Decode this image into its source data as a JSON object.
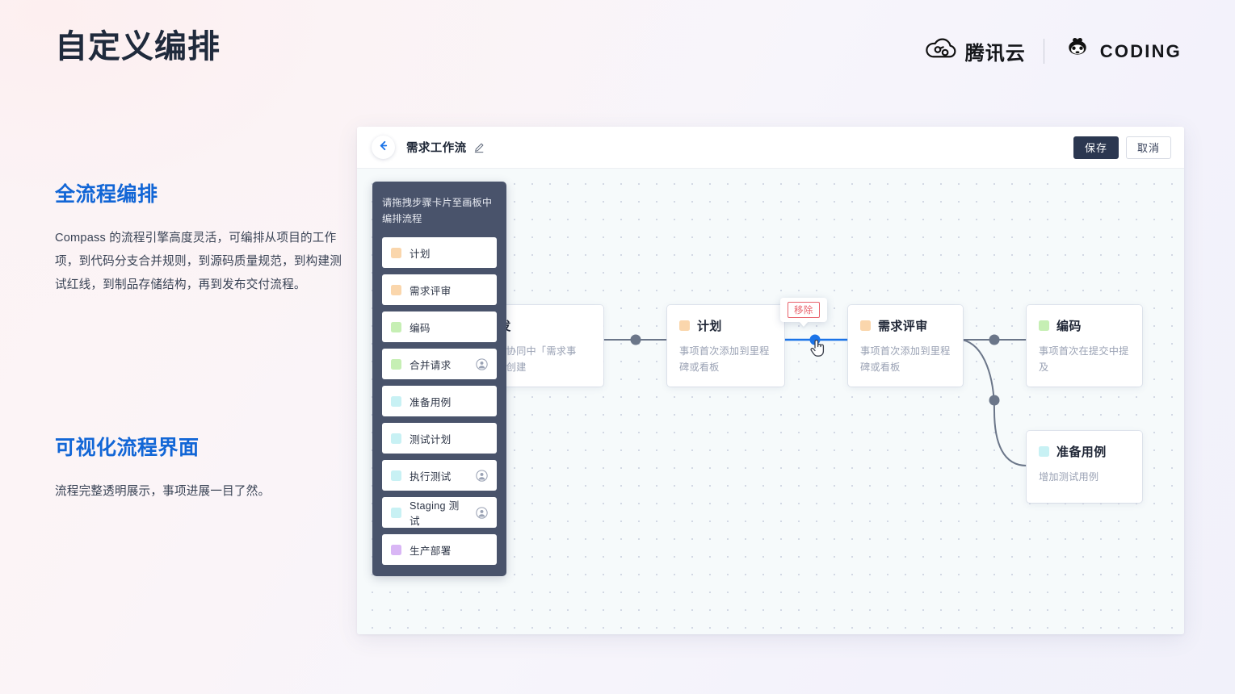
{
  "hero": {
    "title": "自定义编排"
  },
  "brand": {
    "tencent_cloud": "腾讯云",
    "coding": "CODING",
    "cloud_icon": "tencent-cloud-icon",
    "monkey_icon": "coding-monkey-icon"
  },
  "sections": [
    {
      "heading": "全流程编排",
      "body": "Compass 的流程引擎高度灵活，可编排从项目的工作项，到代码分支合并规则，到源码质量规范，到构建测试红线，到制品存储结构，再到发布交付流程。"
    },
    {
      "heading": "可视化流程界面",
      "body": "流程完整透明展示，事项进展一目了然。"
    }
  ],
  "app": {
    "toolbar": {
      "back_icon": "back-arrow-icon",
      "flow_name": "需求工作流",
      "edit_icon": "pencil-edit-icon",
      "save_label": "保存",
      "cancel_label": "取消"
    },
    "palette": {
      "hint": "请拖拽步骤卡片至画板中编排流程",
      "items": [
        {
          "label": "计划",
          "color": "#fad6ac",
          "avatar": false
        },
        {
          "label": "需求评审",
          "color": "#fad6ac",
          "avatar": false
        },
        {
          "label": "编码",
          "color": "#c6efb4",
          "avatar": false
        },
        {
          "label": "合并请求",
          "color": "#c6efb4",
          "avatar": true,
          "avatar_icon": "user-avatar-icon"
        },
        {
          "label": "准备用例",
          "color": "#c8f1f4",
          "avatar": false
        },
        {
          "label": "测试计划",
          "color": "#c8f1f4",
          "avatar": false
        },
        {
          "label": "执行测试",
          "color": "#c8f1f4",
          "avatar": true,
          "avatar_icon": "user-avatar-icon"
        },
        {
          "label": "Staging 测试",
          "color": "#c8f1f4",
          "avatar": true,
          "avatar_icon": "user-avatar-icon"
        },
        {
          "label": "生产部署",
          "color": "#d9b6f5",
          "avatar": false
        }
      ]
    },
    "canvas": {
      "nodes": [
        {
          "id": "trigger",
          "title": "触发",
          "desc": "项目协同中「需求事项」创建",
          "color": "#8fa3c8",
          "has_chip": false
        },
        {
          "id": "plan",
          "title": "计划",
          "desc": "事项首次添加到里程碑或看板",
          "color": "#fad6ac",
          "has_chip": true
        },
        {
          "id": "review",
          "title": "需求评审",
          "desc": "事项首次添加到里程碑或看板",
          "color": "#fad6ac",
          "has_chip": true
        },
        {
          "id": "code",
          "title": "编码",
          "desc": "事项首次在提交中提及",
          "color": "#c6efb4",
          "has_chip": true
        },
        {
          "id": "testcase",
          "title": "准备用例",
          "desc": "增加测试用例",
          "color": "#c8f1f4",
          "has_chip": true
        }
      ],
      "tooltip": {
        "label": "移除",
        "accent": "#e8616b"
      },
      "edge_color": "#6b7689",
      "active_edge_color": "#1a73e8"
    }
  },
  "colors": {
    "heading_blue": "#1266d6",
    "title_dark": "#1f2a3c",
    "primary_btn": "#2b3750",
    "palette_bg": "#49536b"
  }
}
